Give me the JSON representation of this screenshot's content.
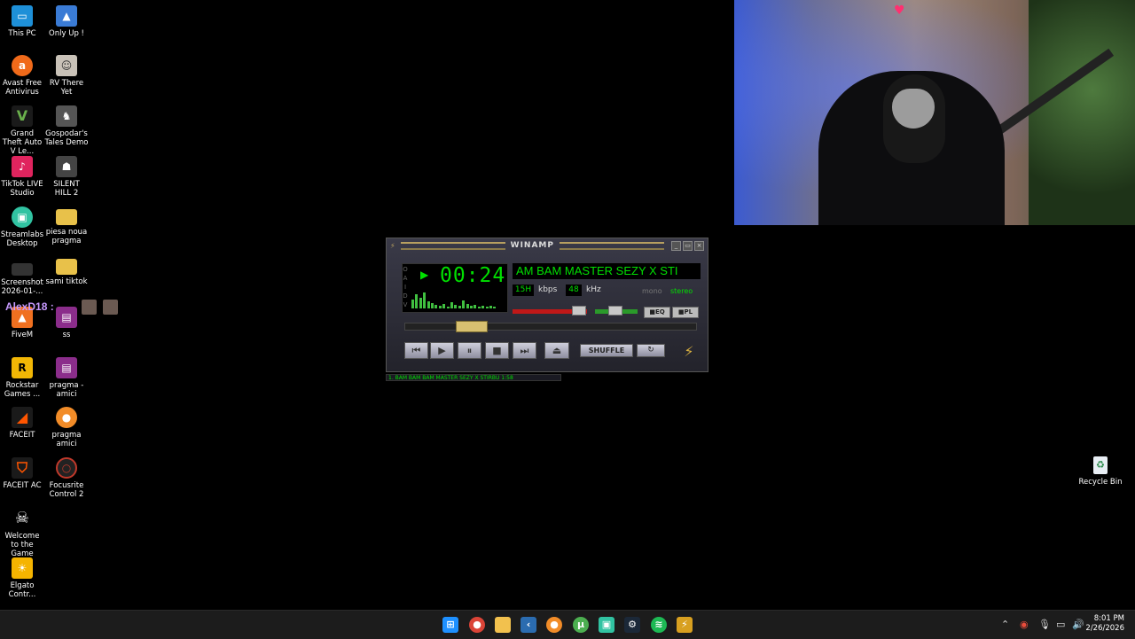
{
  "desktop": {
    "icons": [
      {
        "label": "This PC",
        "icon": "monitor-icon",
        "color": "#1e90d8"
      },
      {
        "label": "Only Up !",
        "icon": "game-icon",
        "color": "#3a7bd5"
      },
      {
        "label": "Avast Free Antivirus",
        "icon": "avast-icon",
        "color": "#f06a1a"
      },
      {
        "label": "RV There Yet",
        "icon": "game-icon",
        "color": "#c9c2b8"
      },
      {
        "label": "Grand Theft Auto V Le...",
        "icon": "gta-icon",
        "color": "#4a8a2a"
      },
      {
        "label": "Gospodar's Tales Demo",
        "icon": "game-icon",
        "color": "#555555"
      },
      {
        "label": "TikTok LIVE Studio",
        "icon": "tiktok-icon",
        "color": "#e0245e"
      },
      {
        "label": "SILENT HILL 2",
        "icon": "game-icon",
        "color": "#444444"
      },
      {
        "label": "Streamlabs Desktop",
        "icon": "streamlabs-icon",
        "color": "#31c3a2"
      },
      {
        "label": "piesa noua pragma",
        "icon": "folder-icon",
        "color": "#e8c14a"
      },
      {
        "label": "Screenshot 2026-01-...",
        "icon": "image-file-icon",
        "color": "#333333"
      },
      {
        "label": "sami tiktok",
        "icon": "folder-icon",
        "color": "#e8c14a"
      },
      {
        "label": "FiveM",
        "icon": "fivem-icon",
        "color": "#f07020"
      },
      {
        "label": "ss",
        "icon": "archive-icon",
        "color": "#8b2d8b"
      },
      {
        "label": "Rockstar Games ...",
        "icon": "rockstar-icon",
        "color": "#f2b705"
      },
      {
        "label": "pragma - amici",
        "icon": "archive-icon",
        "color": "#8b2d8b"
      },
      {
        "label": "FACEIT",
        "icon": "faceit-icon",
        "color": "#ff5500"
      },
      {
        "label": "pragma amici",
        "icon": "flstudio-icon",
        "color": "#f28c28"
      },
      {
        "label": "FACEIT AC",
        "icon": "faceit-ac-icon",
        "color": "#ff5500"
      },
      {
        "label": "Focusrite Control 2",
        "icon": "focusrite-icon",
        "color": "#c0392b"
      },
      {
        "label": "Welcome to the Game",
        "icon": "skull-icon",
        "color": "#222222"
      },
      {
        "label": "Elgato Contr...",
        "icon": "elgato-icon",
        "color": "#f5b400"
      }
    ],
    "recycle_bin": "Recycle Bin"
  },
  "overlay": {
    "username": "AlexD18 :"
  },
  "winamp": {
    "title": "WINAMP",
    "time": "00:24",
    "song_title": "AM BAM  MASTER SEZY X STI",
    "kbps": "15H",
    "kbps_label": "kbps",
    "khz": "48",
    "khz_label": "kHz",
    "mono": "mono",
    "stereo": "stereo",
    "eq_label": "EQ",
    "pl_label": "PL",
    "shuffle_label": "SHUFFLE",
    "volume_level": 0.85,
    "seek_position": 0.25,
    "playlist_strip": "1. BAM BAM BAM  MASTER SEZY X STIRBU      1:58"
  },
  "taskbar": {
    "apps": [
      {
        "name": "start-icon",
        "color": "#1e90ff"
      },
      {
        "name": "chrome-icon",
        "color": "#db4437"
      },
      {
        "name": "file-explorer-icon",
        "color": "#f2c14e"
      },
      {
        "name": "capcut-icon",
        "color": "#2b6cb0"
      },
      {
        "name": "fl-studio-icon",
        "color": "#f28c28"
      },
      {
        "name": "utorrent-icon",
        "color": "#4caf50"
      },
      {
        "name": "streamlabs-icon",
        "color": "#31c3a2"
      },
      {
        "name": "steam-icon",
        "color": "#1b2838"
      },
      {
        "name": "spotify-icon",
        "color": "#1db954"
      },
      {
        "name": "winamp-icon",
        "color": "#d8a020"
      }
    ],
    "clock_time": "8:01 PM",
    "clock_date": "2/26/2026"
  }
}
